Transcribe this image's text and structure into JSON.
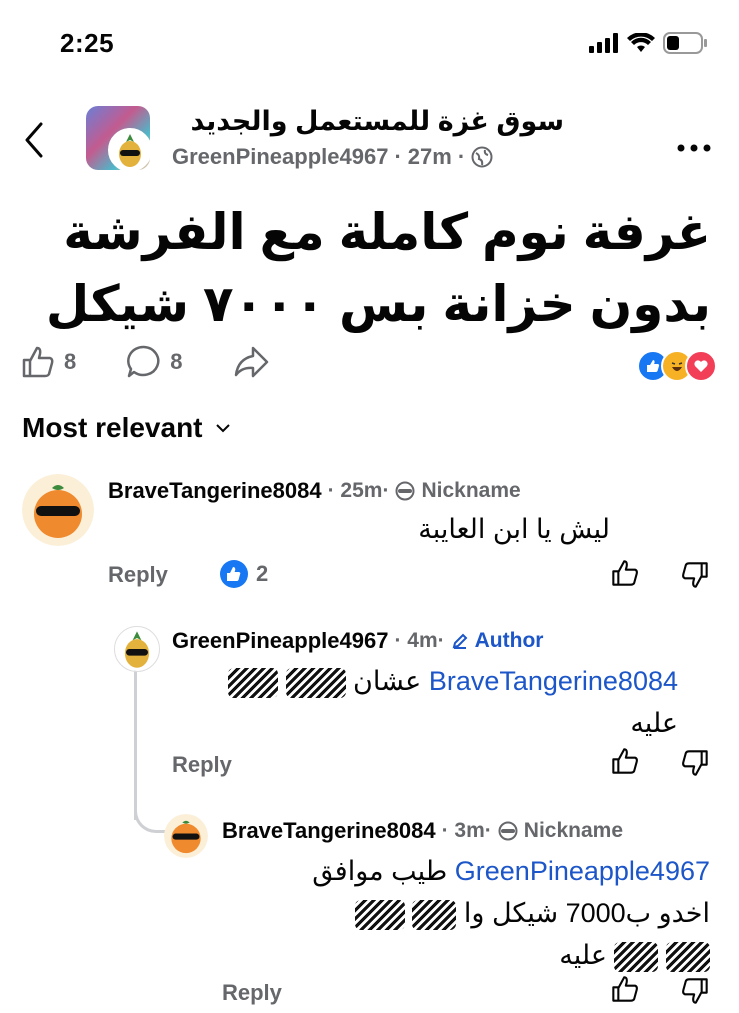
{
  "status_bar": {
    "time": "2:25"
  },
  "post": {
    "group_name": "سوق غزة  للمستعمل والجديد",
    "author": "GreenPineapple4967",
    "time_sep": "·",
    "time": "27m",
    "text_line1": "غرفة نوم كاملة مع الفرشة",
    "text_line2": "بدون خزانة بس ٧٠٠٠ شيكل",
    "like_count": "8",
    "comment_count": "8"
  },
  "sort_label": "Most relevant",
  "comments": [
    {
      "name": "BraveTangerine8084",
      "time": "· 25m·",
      "badge": "Nickname",
      "text": "ليش يا ابن العايبة",
      "reply_label": "Reply",
      "like_count": "2"
    },
    {
      "name": "GreenPineapple4967",
      "time": "· 4m·",
      "badge": "Author",
      "mention": "BraveTangerine8084",
      "text_after_mention": "عشان",
      "text_line2": "عليه",
      "reply_label": "Reply"
    },
    {
      "name": "BraveTangerine8084",
      "time": "· 3m·",
      "badge": "Nickname",
      "mention": "GreenPineapple4967",
      "text_after_mention": "طيب موافق",
      "text_line2": "اخدو ب7000 شيكل وا",
      "text_line3": "عليه",
      "reply_label": "Reply"
    }
  ],
  "colors": {
    "link": "#1c56c8",
    "muted": "#65676b",
    "like_blue": "#1877f2",
    "love_red": "#f33e58"
  }
}
